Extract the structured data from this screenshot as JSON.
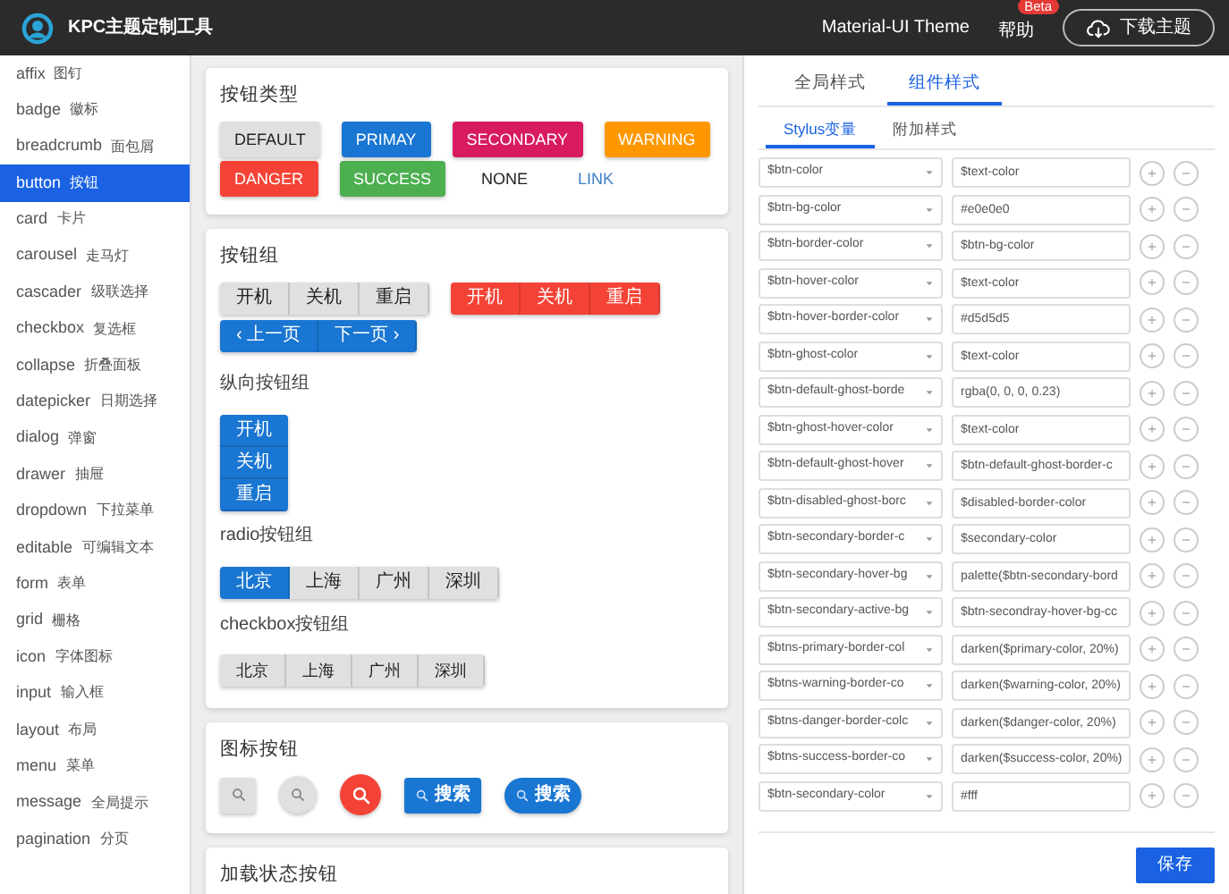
{
  "header": {
    "title": "KPC主题定制工具",
    "theme_link": "Material-UI Theme",
    "beta_badge": "Beta",
    "help_link": "帮助",
    "download_button": "下载主题"
  },
  "sidebar": {
    "items": [
      {
        "label": "affix",
        "sublabel": "图钉",
        "selected": false
      },
      {
        "label": "badge",
        "sublabel": "徽标",
        "selected": false
      },
      {
        "label": "breadcrumb",
        "sublabel": "面包屑",
        "selected": false
      },
      {
        "label": "button",
        "sublabel": "按钮",
        "selected": true
      },
      {
        "label": "card",
        "sublabel": "卡片",
        "selected": false
      },
      {
        "label": "carousel",
        "sublabel": "走马灯",
        "selected": false
      },
      {
        "label": "cascader",
        "sublabel": "级联选择",
        "selected": false
      },
      {
        "label": "checkbox",
        "sublabel": "复选框",
        "selected": false
      },
      {
        "label": "collapse",
        "sublabel": "折叠面板",
        "selected": false
      },
      {
        "label": "datepicker",
        "sublabel": "日期选择",
        "selected": false
      },
      {
        "label": "dialog",
        "sublabel": "弹窗",
        "selected": false
      },
      {
        "label": "drawer",
        "sublabel": "抽屉",
        "selected": false
      },
      {
        "label": "dropdown",
        "sublabel": "下拉菜单",
        "selected": false
      },
      {
        "label": "editable",
        "sublabel": "可编辑文本",
        "selected": false
      },
      {
        "label": "form",
        "sublabel": "表单",
        "selected": false
      },
      {
        "label": "grid",
        "sublabel": "栅格",
        "selected": false
      },
      {
        "label": "icon",
        "sublabel": "字体图标",
        "selected": false
      },
      {
        "label": "input",
        "sublabel": "输入框",
        "selected": false
      },
      {
        "label": "layout",
        "sublabel": "布局",
        "selected": false
      },
      {
        "label": "menu",
        "sublabel": "菜单",
        "selected": false
      },
      {
        "label": "message",
        "sublabel": "全局提示",
        "selected": false
      },
      {
        "label": "pagination",
        "sublabel": "分页",
        "selected": false
      }
    ]
  },
  "button_types": {
    "title": "按钮类型",
    "buttons": [
      {
        "label": "DEFAULT",
        "kind": "default"
      },
      {
        "label": "PRIMAY",
        "kind": "primary"
      },
      {
        "label": "SECONDARY",
        "kind": "secondary"
      },
      {
        "label": "WARNING",
        "kind": "warning"
      },
      {
        "label": "DANGER",
        "kind": "danger"
      },
      {
        "label": "SUCCESS",
        "kind": "success"
      },
      {
        "label": "NONE",
        "kind": "none"
      },
      {
        "label": "LINK",
        "kind": "link"
      }
    ]
  },
  "button_groups": {
    "title": "按钮组",
    "groups": [
      {
        "kind": "default",
        "buttons": [
          "开机",
          "关机",
          "重启"
        ]
      },
      {
        "kind": "danger",
        "buttons": [
          "开机",
          "关机",
          "重启"
        ]
      },
      {
        "kind": "primary",
        "buttons": [
          "‹ 上一页",
          "下一页 ›"
        ]
      }
    ],
    "vertical_title": "纵向按钮组",
    "vertical_buttons": [
      "开机",
      "关机",
      "重启"
    ],
    "radio_title": "radio按钮组",
    "radio_buttons": [
      {
        "label": "北京",
        "selected": true
      },
      {
        "label": "上海",
        "selected": false
      },
      {
        "label": "广州",
        "selected": false
      },
      {
        "label": "深圳",
        "selected": false
      }
    ],
    "checkbox_title": "checkbox按钮组",
    "checkbox_buttons": [
      {
        "label": "北京",
        "checked": false
      },
      {
        "label": "上海",
        "checked": false
      },
      {
        "label": "广州",
        "checked": false
      },
      {
        "label": "深圳",
        "checked": false
      }
    ]
  },
  "icon_buttons": {
    "title": "图标按钮",
    "buttons": [
      {
        "kind": "square"
      },
      {
        "kind": "circle"
      },
      {
        "kind": "danger-circle"
      },
      {
        "kind": "primary",
        "label": "搜索"
      },
      {
        "kind": "primary-pill",
        "label": "搜索"
      }
    ]
  },
  "loading_buttons": {
    "title": "加载状态按钮"
  },
  "panel": {
    "tabs": [
      {
        "label": "全局样式",
        "selected": false
      },
      {
        "label": "组件样式",
        "selected": true
      }
    ],
    "subtabs": [
      {
        "label": "Stylus变量",
        "selected": true
      },
      {
        "label": "附加样式",
        "selected": false
      }
    ],
    "variables": [
      {
        "name": "$btn-color",
        "value": "$text-color"
      },
      {
        "name": "$btn-bg-color",
        "value": "#e0e0e0"
      },
      {
        "name": "$btn-border-color",
        "value": "$btn-bg-color"
      },
      {
        "name": "$btn-hover-color",
        "value": "$text-color"
      },
      {
        "name": "$btn-hover-border-color",
        "value": "#d5d5d5"
      },
      {
        "name": "$btn-ghost-color",
        "value": "$text-color"
      },
      {
        "name": "$btn-default-ghost-borde",
        "value": "rgba(0, 0, 0, 0.23)"
      },
      {
        "name": "$btn-ghost-hover-color",
        "value": "$text-color"
      },
      {
        "name": "$btn-default-ghost-hover",
        "value": "$btn-default-ghost-border-c"
      },
      {
        "name": "$btn-disabled-ghost-borc",
        "value": "$disabled-border-color"
      },
      {
        "name": "$btn-secondary-border-c",
        "value": "$secondary-color"
      },
      {
        "name": "$btn-secondary-hover-bg",
        "value": "palette($btn-secondary-bord"
      },
      {
        "name": "$btn-secondary-active-bg",
        "value": "$btn-secondray-hover-bg-cc"
      },
      {
        "name": "$btns-primary-border-col",
        "value": "darken($primary-color, 20%)"
      },
      {
        "name": "$btns-warning-border-co",
        "value": "darken($warning-color, 20%)"
      },
      {
        "name": "$btns-danger-border-colc",
        "value": "darken($danger-color, 20%)"
      },
      {
        "name": "$btns-success-border-co",
        "value": "darken($success-color, 20%)"
      },
      {
        "name": "$btn-secondary-color",
        "value": "#fff"
      }
    ],
    "save_button": "保存"
  }
}
